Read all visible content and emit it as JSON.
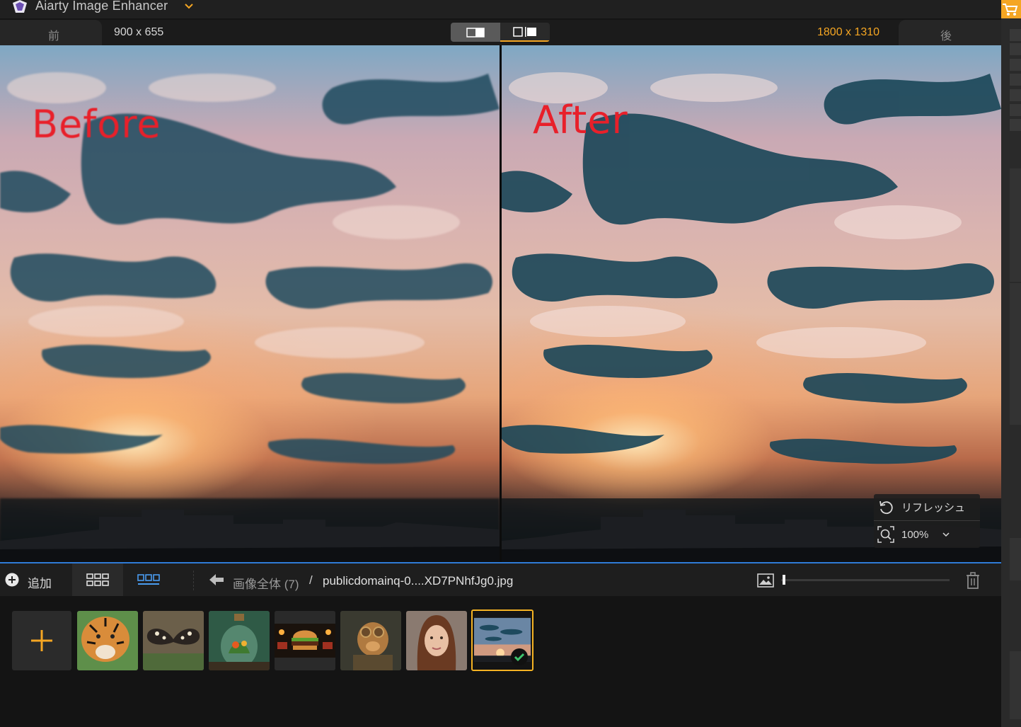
{
  "app": {
    "title": "Aiarty Image Enhancer"
  },
  "compare": {
    "before_tab": "前",
    "after_tab": "後",
    "before_size": "900 x 655",
    "after_size": "1800 x 1310"
  },
  "preview": {
    "before_label": "Before",
    "after_label": "After"
  },
  "overlay": {
    "refresh_label": "リフレッシュ",
    "zoom_value": "100%"
  },
  "toolbar": {
    "add_label": "追加",
    "breadcrumb_root": "画像全体 (7)",
    "breadcrumb_sep": "/",
    "breadcrumb_file": "publicdomainq-0....XD7PNhfJg0.jpg",
    "thumb_size_fraction": 0.01
  },
  "thumbnails": [
    {
      "subject": "tiger"
    },
    {
      "subject": "butterfly"
    },
    {
      "subject": "terrarium-jar"
    },
    {
      "subject": "burger"
    },
    {
      "subject": "steampunk-dog"
    },
    {
      "subject": "woman-portrait"
    },
    {
      "subject": "sunset-sky",
      "selected": true,
      "processed": true
    }
  ],
  "colors": {
    "accent": "#f5a623",
    "toolbar_border": "#2f7bd6",
    "label_red": "#e8202a",
    "check_green": "#3ec46d"
  }
}
